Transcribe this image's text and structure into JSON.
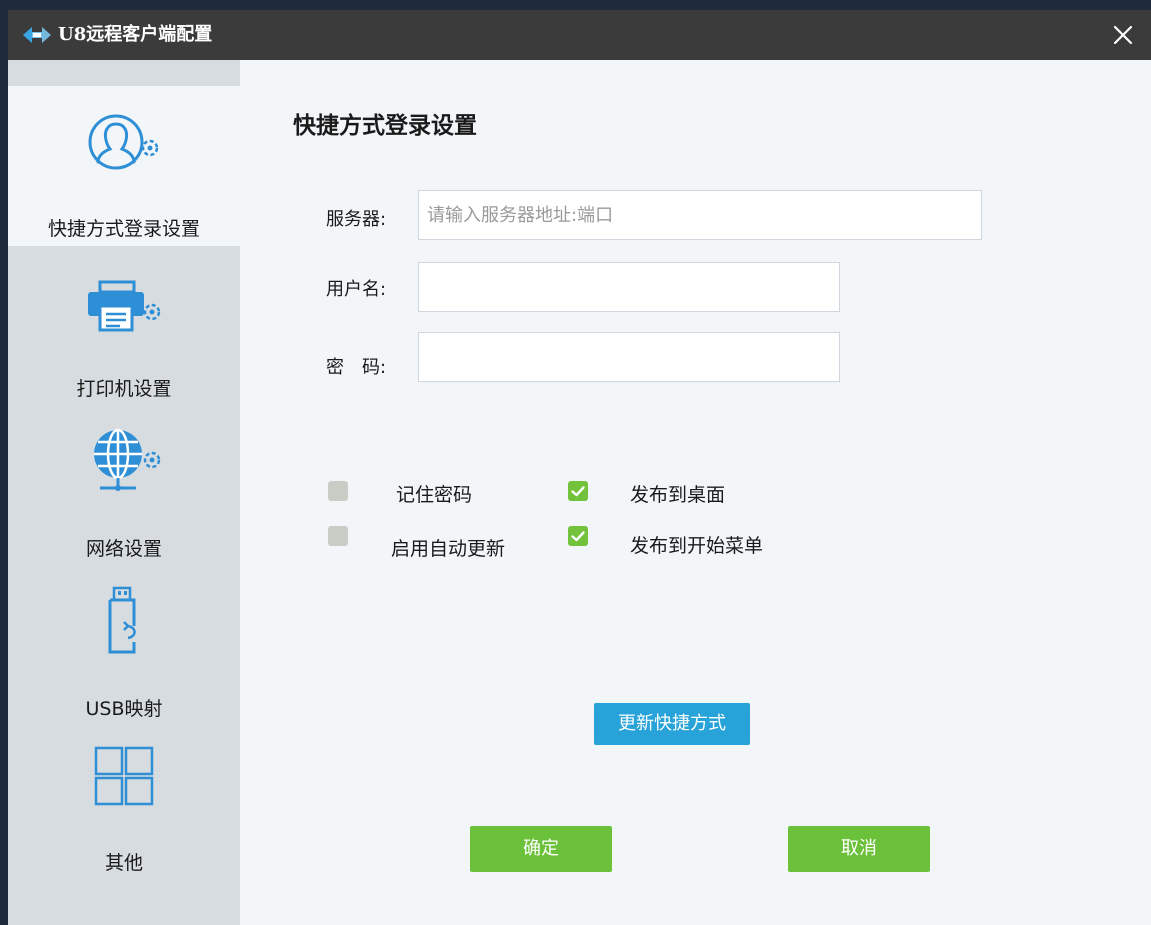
{
  "window": {
    "title": "U8远程客户端配置"
  },
  "sidebar": {
    "items": [
      {
        "label": "快捷方式登录设置",
        "icon": "user-gear-icon",
        "active": true
      },
      {
        "label": "打印机设置",
        "icon": "printer-gear-icon",
        "active": false
      },
      {
        "label": "网络设置",
        "icon": "globe-gear-icon",
        "active": false
      },
      {
        "label": "USB映射",
        "icon": "usb-icon",
        "active": false
      },
      {
        "label": "其他",
        "icon": "grid-icon",
        "active": false
      }
    ]
  },
  "panel": {
    "title": "快捷方式登录设置",
    "server": {
      "label": "服务器:",
      "placeholder": "请输入服务器地址:端口",
      "value": ""
    },
    "username": {
      "label": "用户名:",
      "value": ""
    },
    "password": {
      "label": "密　码:",
      "value": ""
    },
    "options": [
      {
        "label": "记住密码",
        "checked": false
      },
      {
        "label": "发布到桌面",
        "checked": true
      },
      {
        "label": "启用自动更新",
        "checked": false
      },
      {
        "label": "发布到开始菜单",
        "checked": true
      }
    ],
    "update_button": "更新快捷方式",
    "ok_button": "确定",
    "cancel_button": "取消"
  },
  "colors": {
    "titlebar": "#3b3b3b",
    "sidebar": "#d7dce1",
    "content": "#f3f6f9",
    "accent_blue": "#27a3d9",
    "accent_green": "#6cc13a",
    "icon_blue": "#2f8fd6"
  }
}
